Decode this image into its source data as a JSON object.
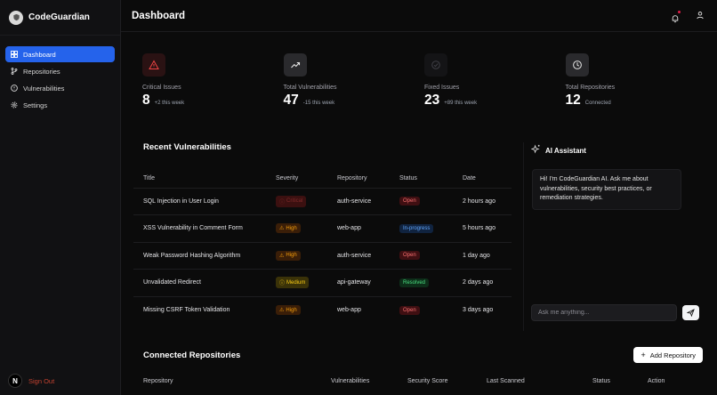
{
  "app": {
    "name": "CodeGuardian"
  },
  "sidebar": {
    "items": [
      {
        "label": "Dashboard",
        "icon": "dashboard-icon"
      },
      {
        "label": "Repositories",
        "icon": "git-branch-icon"
      },
      {
        "label": "Vulnerabilities",
        "icon": "alert-circle-icon"
      },
      {
        "label": "Settings",
        "icon": "gear-icon"
      }
    ],
    "avatar_letter": "N",
    "signout_label": "Sign Out"
  },
  "header": {
    "title": "Dashboard"
  },
  "stats": [
    {
      "label": "Critical Issues",
      "value": "8",
      "sub": "+2 this week",
      "icon": "warning-triangle-icon",
      "color": "#ef4444",
      "bg": "#2a1213"
    },
    {
      "label": "Total Vulnerabilities",
      "value": "47",
      "sub": "-15 this week",
      "icon": "trending-up-icon",
      "color": "#e5e5e5",
      "bg": "#2a2a2d"
    },
    {
      "label": "Fixed Issues",
      "value": "23",
      "sub": "+89 this week",
      "icon": "check-circle-icon",
      "color": "#3f3f46",
      "bg": "#141416"
    },
    {
      "label": "Total Repositories",
      "value": "12",
      "sub": "Connected",
      "icon": "clock-icon",
      "color": "#e5e5e5",
      "bg": "#2a2a2d"
    }
  ],
  "vulnerabilities": {
    "title": "Recent Vulnerabilities",
    "columns": [
      "Title",
      "Severity",
      "Repository",
      "Status",
      "Date"
    ],
    "rows": [
      {
        "title": "SQL Injection in User Login",
        "severity": "Critical",
        "repo": "auth-service",
        "status": "Open",
        "date": "2 hours ago"
      },
      {
        "title": "XSS Vulnerability in Comment Form",
        "severity": "High",
        "repo": "web-app",
        "status": "In-progress",
        "date": "5 hours ago"
      },
      {
        "title": "Weak Password Hashing Algorithm",
        "severity": "High",
        "repo": "auth-service",
        "status": "Open",
        "date": "1 day ago"
      },
      {
        "title": "Unvalidated Redirect",
        "severity": "Medium",
        "repo": "api-gateway",
        "status": "Resolved",
        "date": "2 days ago"
      },
      {
        "title": "Missing CSRF Token Validation",
        "severity": "High",
        "repo": "web-app",
        "status": "Open",
        "date": "3 days ago"
      }
    ]
  },
  "assistant": {
    "title": "AI Assistant",
    "message": "Hi! I'm CodeGuardian AI. Ask me about vulnerabilities, security best practices, or remediation strategies.",
    "placeholder": "Ask me anything..."
  },
  "repositories": {
    "title": "Connected Repositories",
    "add_label": "Add Repository",
    "columns": [
      "Repository",
      "Vulnerabilities",
      "Security Score",
      "Last Scanned",
      "Status",
      "Action"
    ]
  }
}
